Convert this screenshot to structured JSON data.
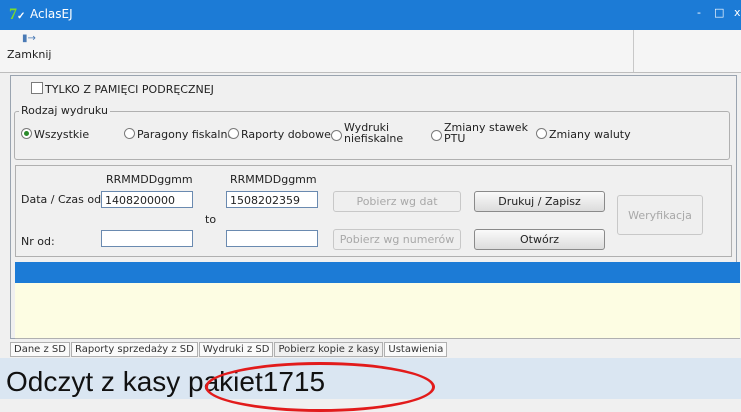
{
  "window": {
    "title": "AclasEJ",
    "icon": "app-logo-icon",
    "minimize": "-",
    "maximize": "□",
    "close": "x"
  },
  "toolbar": {
    "close_label": "Zamknij",
    "close_icon": "exit-door-icon"
  },
  "cache_checkbox": {
    "label": "TYLKO Z PAMIĘCI PODRĘCZNEJ",
    "checked": false
  },
  "print_type": {
    "title": "Rodzaj wydruku",
    "options": [
      {
        "label": "Wszystkie",
        "selected": true
      },
      {
        "label": "Paragony fiskalne",
        "selected": false
      },
      {
        "label": "Raporty dobowe",
        "selected": false
      },
      {
        "label_line1": "Wydruki",
        "label_line2": "niefiskalne",
        "selected": false
      },
      {
        "label_line1": "Zmiany stawek",
        "label_line2": "PTU",
        "selected": false
      },
      {
        "label": "Zmiany waluty",
        "selected": false
      }
    ]
  },
  "filters": {
    "format_hint_from": "RRMMDDggmm",
    "format_hint_to": "RRMMDDggmm",
    "date_label": "Data / Czas od:",
    "date_from": "1408200000",
    "to_label": "to",
    "date_to": "1508202359",
    "number_label": "Nr od:",
    "number_from": "",
    "number_to": "",
    "fetch_by_dates": "Pobierz wg dat",
    "fetch_by_numbers": "Pobierz wg numerów",
    "print_save": "Drukuj / Zapisz",
    "open": "Otwórz",
    "verify": "Weryfikacja"
  },
  "tabs": [
    "Dane z SD",
    "Raporty sprzedaży z SD",
    "Wydruki z SD",
    "Pobierz kopie z kasy",
    "Ustawienia"
  ],
  "status": {
    "text": "Odczyt z kasy pakiet1715"
  },
  "colors": {
    "titlebar": "#1c7bd6",
    "list_header": "#1c7bd6",
    "list_body": "#fdfde3",
    "highlight_ellipse": "#e21b1b",
    "status_bar": "#dae6f2"
  }
}
